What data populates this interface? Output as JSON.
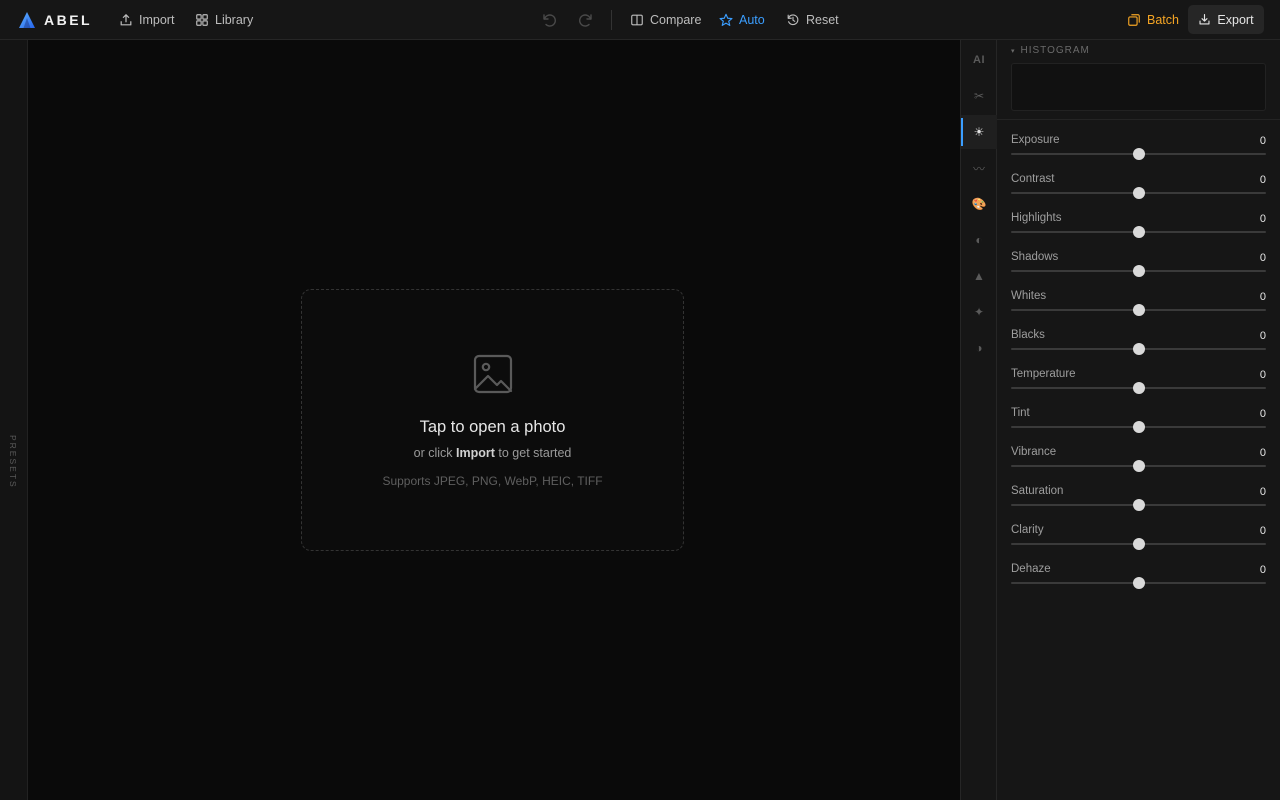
{
  "app": {
    "name": "ABEL"
  },
  "toolbar": {
    "import_label": "Import",
    "library_label": "Library",
    "compare_label": "Compare",
    "auto_label": "Auto",
    "reset_label": "Reset",
    "batch_label": "Batch",
    "export_label": "Export"
  },
  "presets": {
    "label": "PRESETS"
  },
  "dropzone": {
    "title": "Tap to open a photo",
    "sub_prefix": "or click",
    "sub_link": "Import",
    "sub_suffix": "to get started",
    "formats": "Supports JPEG, PNG, WebP, HEIC, TIFF"
  },
  "tools": [
    {
      "name": "ai-tool",
      "glyph": "AI"
    },
    {
      "name": "crop-tool",
      "glyph": "✂"
    },
    {
      "name": "light-tool",
      "glyph": "☀"
    },
    {
      "name": "curves-tool",
      "glyph": "〰"
    },
    {
      "name": "color-tool",
      "glyph": "🎨"
    },
    {
      "name": "tone-tool",
      "glyph": "◐"
    },
    {
      "name": "detail-tool",
      "glyph": "▲"
    },
    {
      "name": "effects-tool",
      "glyph": "✦"
    },
    {
      "name": "vignette-tool",
      "glyph": "◑"
    }
  ],
  "active_tool": 2,
  "histogram": {
    "label": "HISTOGRAM",
    "caret": "▾"
  },
  "adjustments": [
    {
      "label": "Exposure",
      "value": "0",
      "level": 0.5
    },
    {
      "label": "Contrast",
      "value": "0",
      "level": 0.5
    },
    {
      "label": "Highlights",
      "value": "0",
      "level": 0.5
    },
    {
      "label": "Shadows",
      "value": "0",
      "level": 0.5
    },
    {
      "label": "Whites",
      "value": "0",
      "level": 0.5
    },
    {
      "label": "Blacks",
      "value": "0",
      "level": 0.5
    },
    {
      "label": "Temperature",
      "value": "0",
      "level": 0.5
    },
    {
      "label": "Tint",
      "value": "0",
      "level": 0.5
    },
    {
      "label": "Vibrance",
      "value": "0",
      "level": 0.5
    },
    {
      "label": "Saturation",
      "value": "0",
      "level": 0.5
    },
    {
      "label": "Clarity",
      "value": "0",
      "level": 0.5
    },
    {
      "label": "Dehaze",
      "value": "0",
      "level": 0.5
    }
  ],
  "colors": {
    "accent": "#3b9eff",
    "batch": "#f5a524",
    "background": "#0a0a0a",
    "panel": "#161616"
  }
}
